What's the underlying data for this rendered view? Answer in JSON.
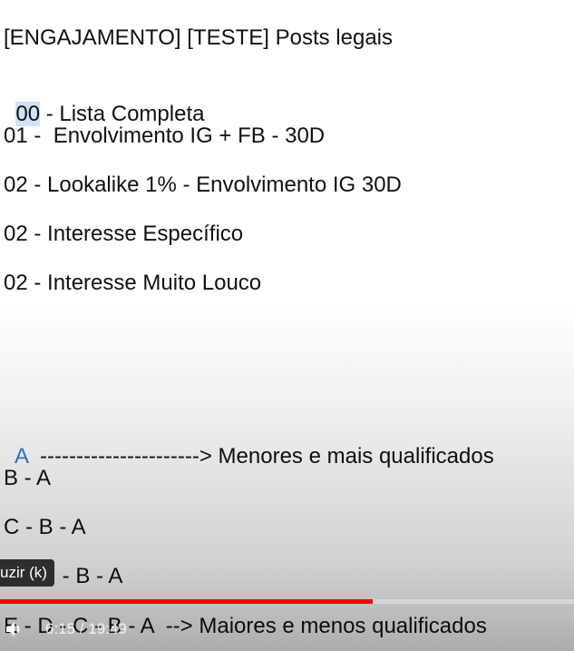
{
  "document": {
    "title": "[ENGAJAMENTO] [TESTE] Posts legais",
    "list": {
      "item0_highlight": "00",
      "item0_rest": " - Lista Completa",
      "item1": "01 -  Envolvimento IG + FB - 30D",
      "item2": "02 - Lookalike 1% - Envolvimento IG 30D",
      "item3": "02 - Interesse Específico",
      "item4": "02 - Interesse Muito Louco"
    },
    "scale": {
      "a_letter": "A",
      "a_rest": "  ----------------------> Menores e mais qualificados",
      "row_b": "B - A",
      "row_c": "C - B - A",
      "row_d_visible": " - B - A",
      "row_e": "E - D - C - B - A  --> Maiores e menos qualificados"
    }
  },
  "player": {
    "tooltip": "uzir (k)",
    "time": "6:15 / 19:49",
    "progress_fraction": 0.65,
    "accent_color": "#ff0000",
    "icons": {
      "volume": "volume-icon"
    }
  }
}
